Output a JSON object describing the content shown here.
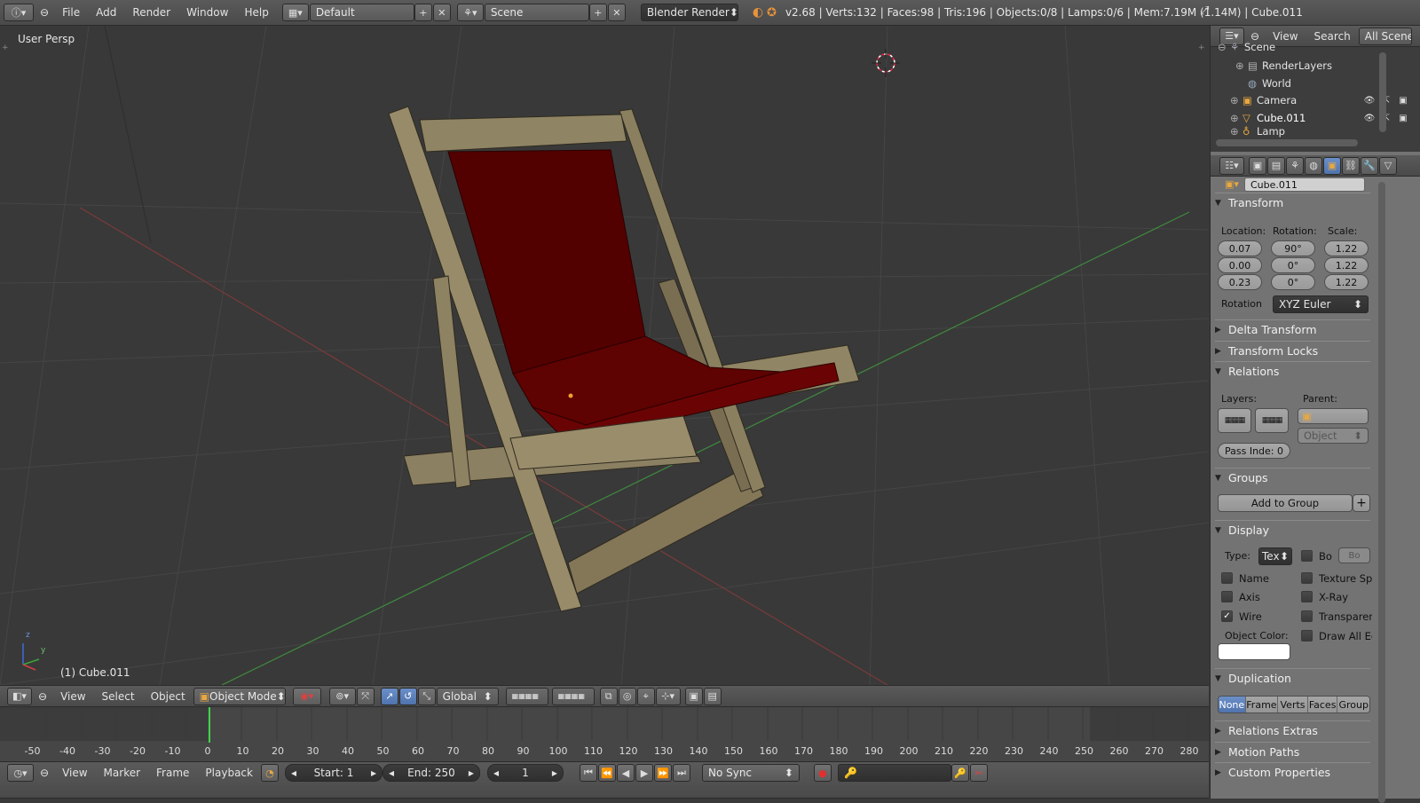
{
  "top_bar": {
    "menus": [
      "File",
      "Add",
      "Render",
      "Window",
      "Help"
    ],
    "layout": "Default",
    "scene": "Scene",
    "render_engine": "Blender Render",
    "stats": "v2.68 | Verts:132 | Faces:98 | Tris:196 | Objects:0/8 | Lamps:0/6 | Mem:7.19M (1.14M) | Cube.011"
  },
  "viewport": {
    "view_label": "User Persp",
    "object_label": "(1) Cube.011"
  },
  "view3d_header": {
    "menus": [
      "View",
      "Select",
      "Object"
    ],
    "mode": "Object Mode",
    "orientation": "Global"
  },
  "outliner": {
    "menus": [
      "View",
      "Search"
    ],
    "filter": "All Scene",
    "items": [
      {
        "label": "Scene",
        "icon": "scene-icon"
      },
      {
        "label": "RenderLayers",
        "icon": "render-layers-icon"
      },
      {
        "label": "World",
        "icon": "world-icon"
      },
      {
        "label": "Camera",
        "icon": "camera-icon"
      },
      {
        "label": "Cube.011",
        "icon": "mesh-icon"
      },
      {
        "label": "Lamp",
        "icon": "lamp-icon"
      }
    ]
  },
  "properties": {
    "object_name": "Cube.011",
    "transform": {
      "title": "Transform",
      "location_label": "Location:",
      "rotation_label": "Rotation:",
      "scale_label": "Scale:",
      "location": [
        "0.07",
        "0.00",
        "0.23"
      ],
      "rotation": [
        "90°",
        "0°",
        "0°"
      ],
      "scale": [
        "1.22",
        "1.22",
        "1.22"
      ],
      "rotation_mode_label": "Rotation",
      "rotation_mode": "XYZ Euler"
    },
    "delta_transform": "Delta Transform",
    "transform_locks": "Transform Locks",
    "relations": {
      "title": "Relations",
      "layers_label": "Layers:",
      "parent_label": "Parent:",
      "parent_type": "Object",
      "pass_index": "Pass Inde: 0"
    },
    "groups": {
      "title": "Groups",
      "add_button": "Add to Group"
    },
    "display": {
      "title": "Display",
      "type_label": "Type:",
      "type_value": "Tex",
      "bounds_label": "Bo",
      "bounds_value": "Bo",
      "name": "Name",
      "axis": "Axis",
      "wire": "Wire",
      "texture_space": "Texture Spa",
      "xray": "X-Ray",
      "transparency": "Transparenc",
      "draw_all_edges": "Draw All Ed",
      "object_color_label": "Object Color:",
      "wire_checked": true
    },
    "duplication": {
      "title": "Duplication",
      "options": [
        "None",
        "Frame",
        "Verts",
        "Faces",
        "Group"
      ],
      "selected": "None"
    },
    "relations_extras": "Relations Extras",
    "motion_paths": "Motion Paths",
    "custom_properties": "Custom Properties"
  },
  "timeline": {
    "ticks": [
      -50,
      -40,
      -30,
      -20,
      -10,
      0,
      10,
      20,
      30,
      40,
      50,
      60,
      70,
      80,
      90,
      100,
      110,
      120,
      130,
      140,
      150,
      160,
      170,
      180,
      190,
      200,
      210,
      220,
      230,
      240,
      250,
      260,
      270,
      280
    ],
    "current_frame_marker": 1,
    "menus": [
      "View",
      "Marker",
      "Frame",
      "Playback"
    ],
    "start": "Start: 1",
    "end": "End: 250",
    "current": "1",
    "sync": "No Sync"
  }
}
